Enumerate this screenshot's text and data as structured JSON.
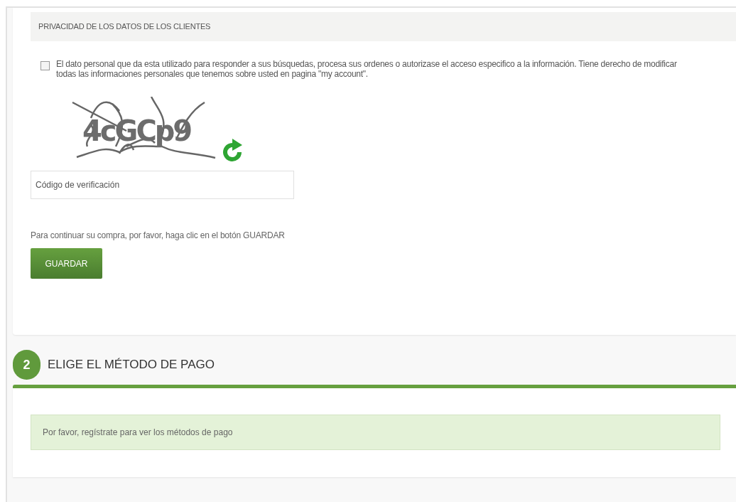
{
  "privacy": {
    "heading": "PRIVACIDAD DE LOS DATOS DE LOS CLIENTES",
    "checked": false,
    "text": "El dato personal que da esta utilizado para responder a sus búsquedas, procesa sus ordenes o autorizase el acceso especifico a la información. Tiene derecho de modificar todas las informaciones personales que tenemos sobre usted en pagina \"my account\"."
  },
  "captcha": {
    "text": "4cGCp9"
  },
  "verification": {
    "placeholder": "Código de verificación"
  },
  "instruction": "Para continuar su compra, por favor, haga clic en el botón GUARDAR",
  "save_button": "GUARDAR",
  "step": {
    "number": "2",
    "title": "ELIGE EL MÉTODO DE PAGO"
  },
  "notice": "Por favor, regístrate para ver los métodos de pago"
}
